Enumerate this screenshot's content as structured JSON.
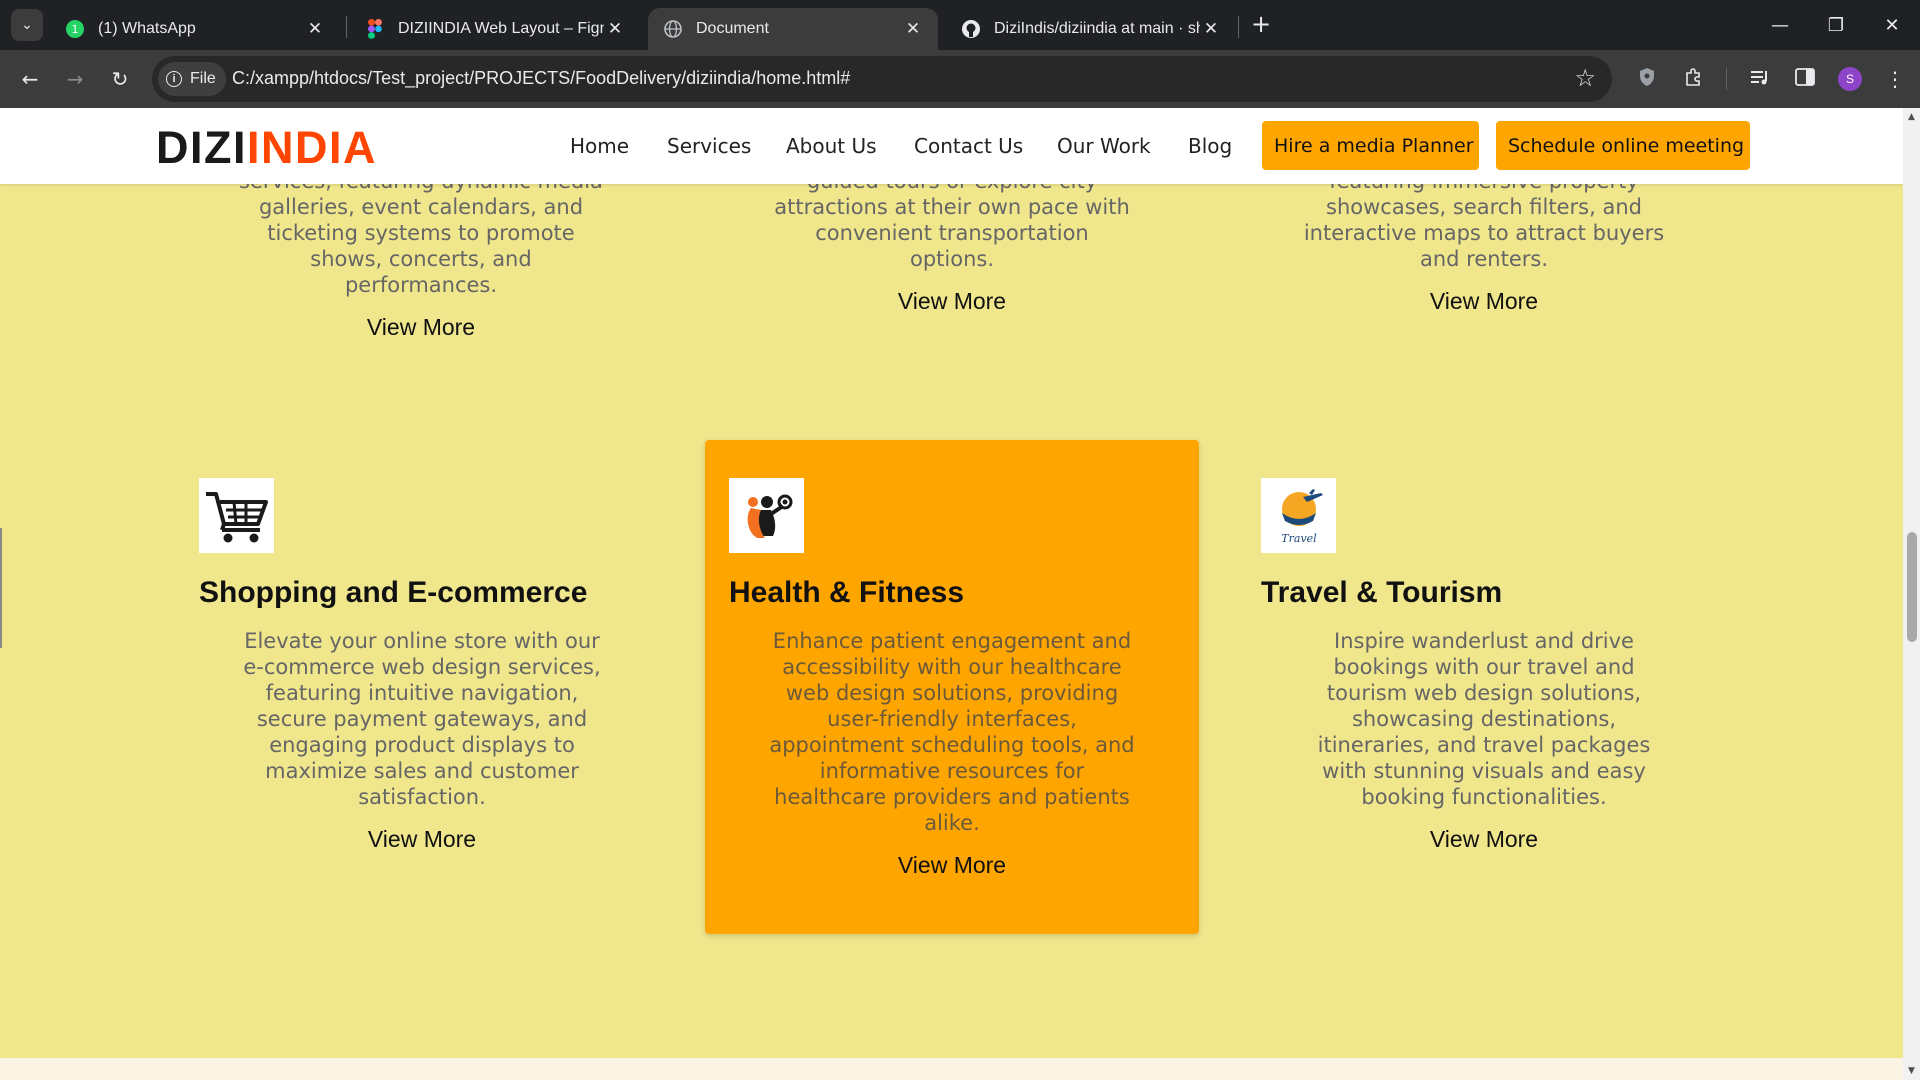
{
  "browser": {
    "tabs": [
      {
        "title": "(1) WhatsApp",
        "icon": "whatsapp-icon",
        "badge": "1"
      },
      {
        "title": "DIZIINDIA Web Layout – Figma",
        "icon": "figma-icon"
      },
      {
        "title": "Document",
        "icon": "globe-icon",
        "active": true
      },
      {
        "title": "DiziIndis/diziindia at main · shar",
        "icon": "github-icon"
      }
    ],
    "address": {
      "scheme_label": "File",
      "url": "C:/xampp/htdocs/Test_project/PROJECTS/FoodDelivery/diziindia/home.html#"
    },
    "profile_initial": "S"
  },
  "site": {
    "logo": {
      "part1": "DIZI",
      "part2": "INDIA",
      "part1_color": "#1a1a1a",
      "part2_color": "#ff4500"
    },
    "nav": [
      "Home",
      "Services",
      "About Us",
      "Contact Us",
      "Our Work",
      "Blog"
    ],
    "cta_primary": "Hire a media Planner",
    "cta_secondary": "Schedule online meeting",
    "accent_color": "#ffa500",
    "background_color": "#f0e68c"
  },
  "cards_top": [
    {
      "lines": [
        "services, featuring dynamic media",
        "galleries, event calendars, and",
        "ticketing systems to promote",
        "shows, concerts, and",
        "performances."
      ],
      "link": "View More"
    },
    {
      "lines": [
        "guided tours or explore city",
        "attractions at their own pace with",
        "convenient transportation",
        "options."
      ],
      "link": "View More"
    },
    {
      "lines": [
        "featuring immersive property",
        "showcases, search filters, and",
        "interactive maps to attract buyers",
        "and renters."
      ],
      "link": "View More"
    }
  ],
  "cards": [
    {
      "title": "Shopping and E-commerce",
      "icon": "shopping-cart-icon",
      "lines": [
        "Elevate your online store with our",
        "e-commerce web design services,",
        "featuring intuitive navigation,",
        "secure payment gateways, and",
        "engaging product displays to",
        "maximize sales and customer",
        "satisfaction."
      ],
      "link": "View More"
    },
    {
      "title": "Health & Fitness",
      "icon": "fitness-icon",
      "lines": [
        "Enhance patient engagement and",
        "accessibility with our healthcare",
        "web design solutions, providing",
        "user-friendly interfaces,",
        "appointment scheduling tools, and",
        "informative resources for",
        "healthcare providers and patients",
        "alike."
      ],
      "link": "View More",
      "highlighted": true
    },
    {
      "title": "Travel & Tourism",
      "icon": "travel-icon",
      "icon_text": "Travel",
      "lines": [
        "Inspire wanderlust and drive",
        "bookings with our travel and",
        "tourism web design solutions,",
        "showcasing destinations,",
        "itineraries, and travel packages",
        "with stunning visuals and easy",
        "booking functionalities."
      ],
      "link": "View More"
    }
  ]
}
